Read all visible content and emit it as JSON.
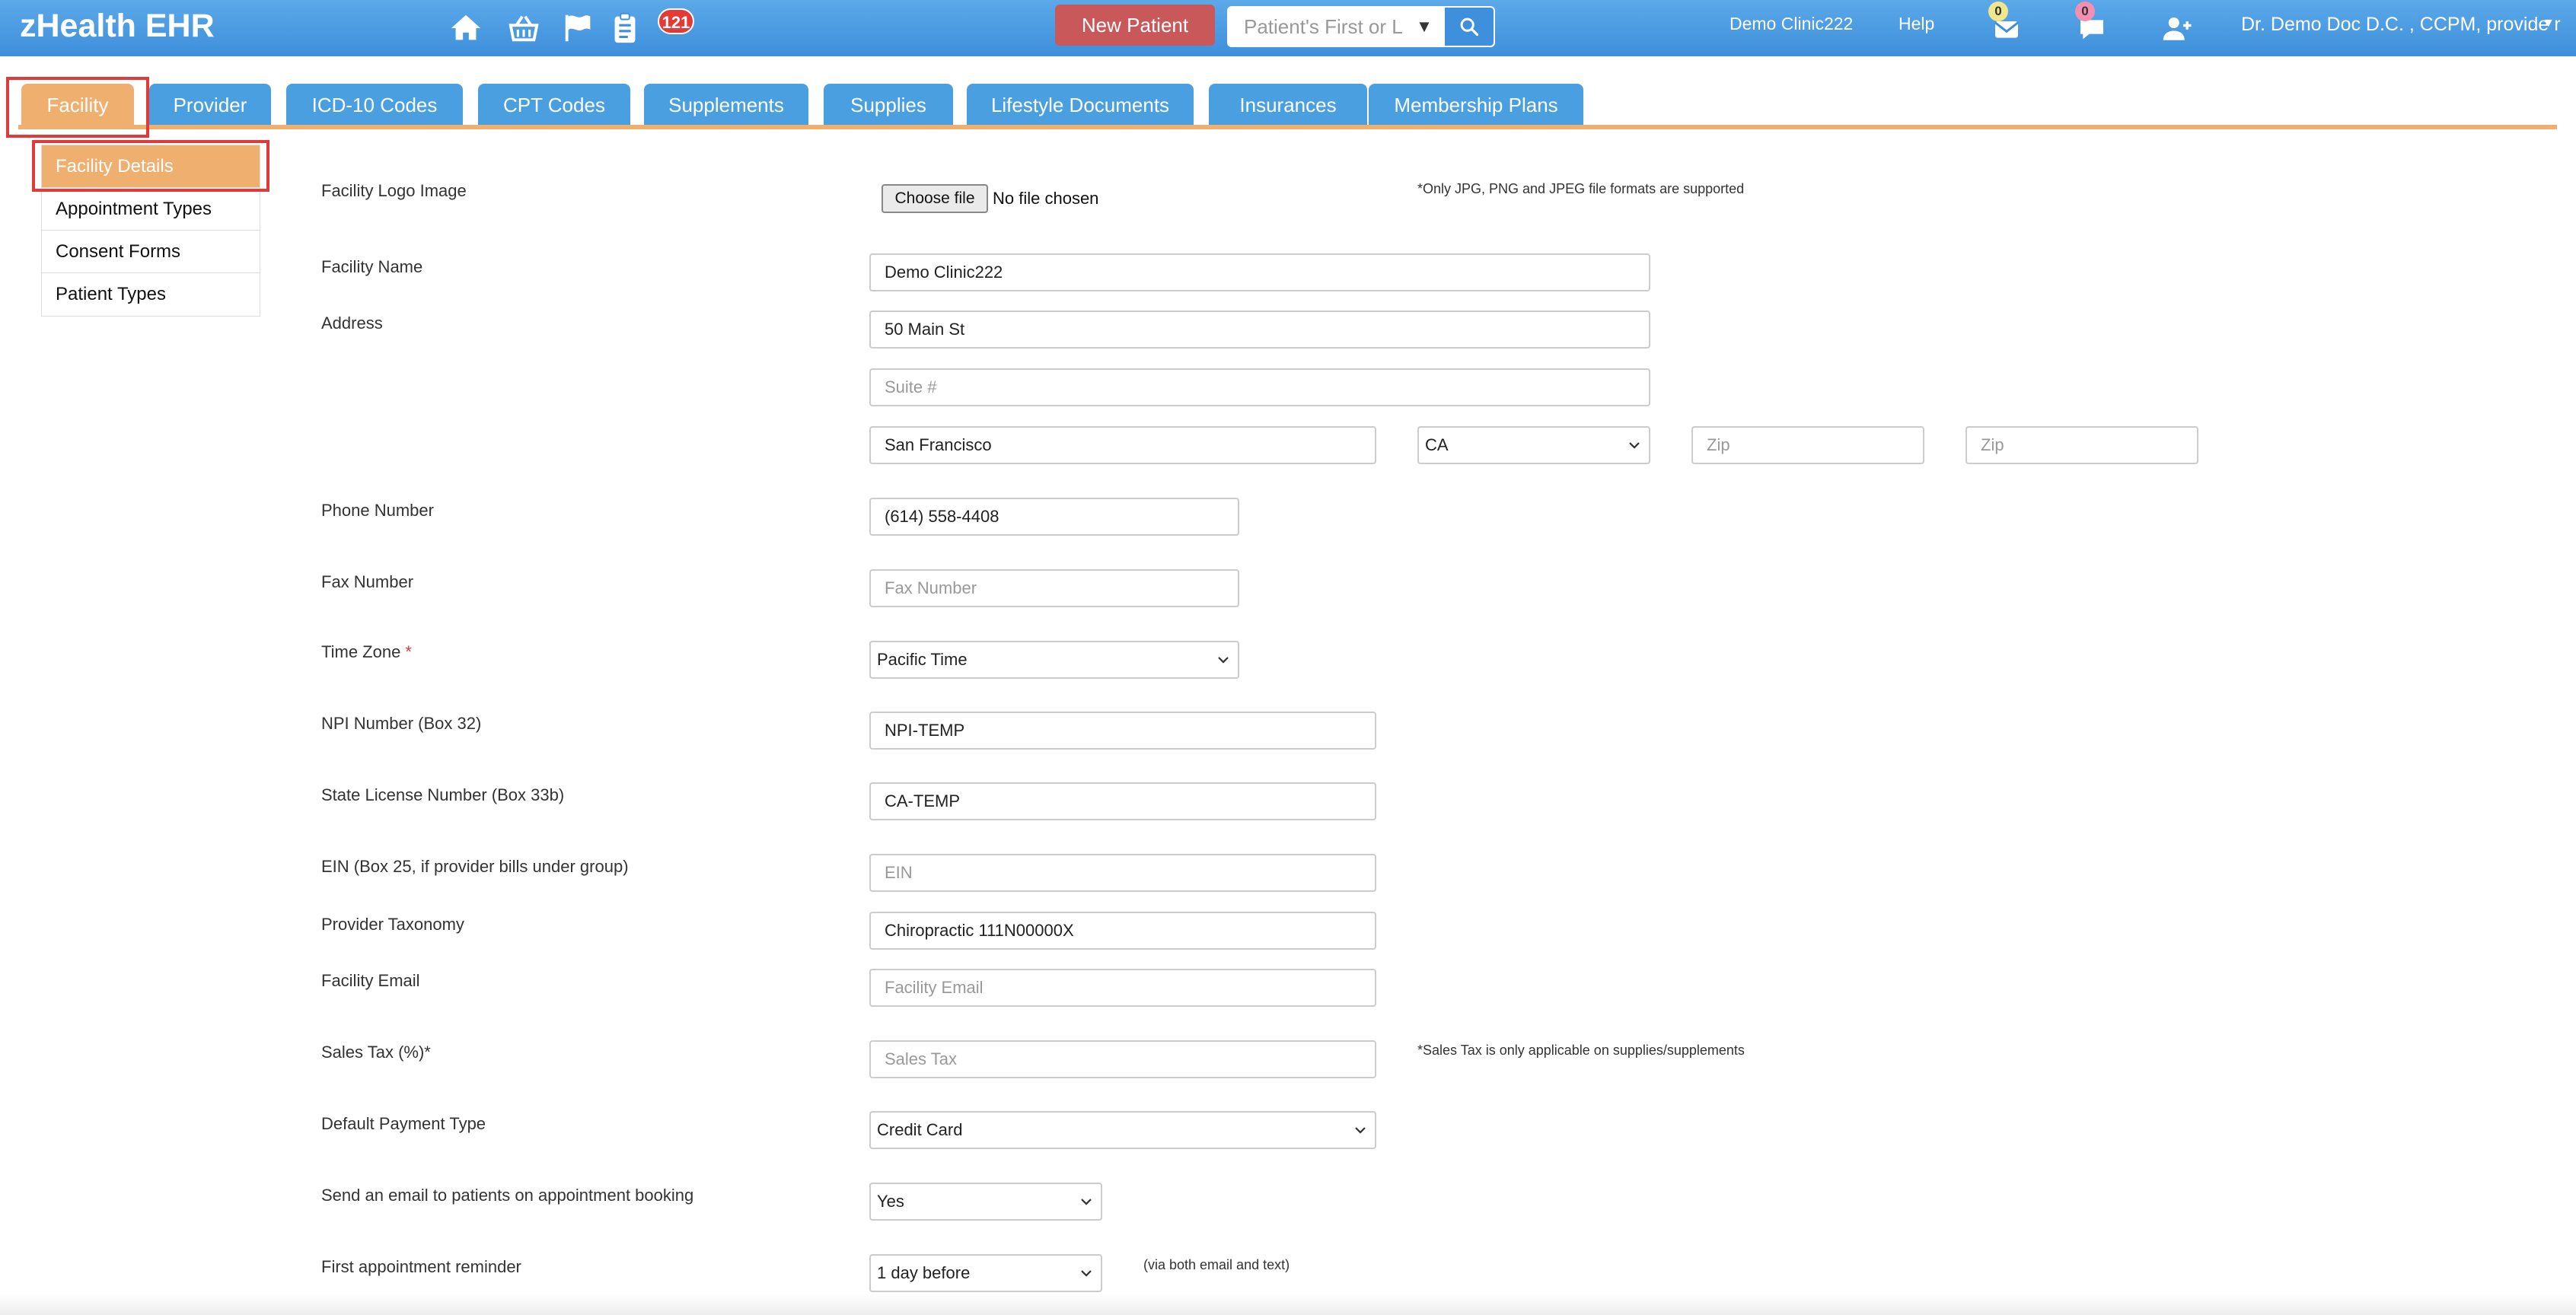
{
  "app": {
    "brand": "zHealth EHR"
  },
  "topbar": {
    "icons": [
      "home-icon",
      "basket-icon",
      "flag-icon",
      "clipboard-icon"
    ],
    "task_count": "121",
    "new_patient_label": "New Patient",
    "search_placeholder": "Patient's First or Last Name",
    "clinic_label": "Demo Clinic222",
    "help_label": "Help",
    "mail_count": "0",
    "chat_count": "0",
    "user_label": "Dr. Demo Doc D.C. , CCPM, provide r",
    "colors": {
      "bar": "#3e8fdc",
      "new_patient": "#c9585a",
      "task_badge": "#e53935",
      "mail_badge": "#f0e68c",
      "chat_badge": "#f48fb1"
    }
  },
  "tabs": [
    {
      "label": "Facility",
      "active": true
    },
    {
      "label": "Provider"
    },
    {
      "label": "ICD-10 Codes"
    },
    {
      "label": "CPT Codes"
    },
    {
      "label": "Supplements"
    },
    {
      "label": "Supplies"
    },
    {
      "label": "Lifestyle Documents"
    },
    {
      "label": "Insurances"
    },
    {
      "label": "Membership Plans"
    }
  ],
  "side_menu": [
    {
      "label": "Facility Details",
      "active": true
    },
    {
      "label": "Appointment Types"
    },
    {
      "label": "Consent Forms"
    },
    {
      "label": "Patient Types"
    }
  ],
  "form": {
    "logo": {
      "label": "Facility Logo Image",
      "button": "Choose file",
      "status": "No file chosen",
      "note": "*Only JPG, PNG and JPEG file formats are supported"
    },
    "facility_name": {
      "label": "Facility Name",
      "value": "Demo Clinic222"
    },
    "address": {
      "label": "Address",
      "line1": "50 Main St",
      "suite_placeholder": "Suite #",
      "city": "San Francisco",
      "state": "CA",
      "zip_placeholder": "Zip",
      "zip2_placeholder": "Zip"
    },
    "phone": {
      "label": "Phone Number",
      "value": "(614) 558-4408"
    },
    "fax": {
      "label": "Fax Number",
      "placeholder": "Fax Number"
    },
    "time_zone": {
      "label": "Time Zone",
      "required": "*",
      "value": "Pacific Time"
    },
    "npi": {
      "label": "NPI Number (Box 32)",
      "value": "NPI-TEMP"
    },
    "state_license": {
      "label": "State License Number (Box 33b)",
      "value": "CA-TEMP"
    },
    "ein": {
      "label": "EIN (Box 25, if provider bills under group)",
      "placeholder": "EIN"
    },
    "taxonomy": {
      "label": "Provider Taxonomy",
      "value": "Chiropractic 111N00000X"
    },
    "email": {
      "label": "Facility Email",
      "placeholder": "Facility Email"
    },
    "sales_tax": {
      "label": "Sales Tax (%)*",
      "placeholder": "Sales Tax",
      "note": "*Sales Tax is only applicable on supplies/supplements"
    },
    "payment_type": {
      "label": "Default Payment Type",
      "value": "Credit Card"
    },
    "send_email": {
      "label": "Send an email to patients on appointment booking",
      "value": "Yes"
    },
    "first_reminder": {
      "label": "First appointment reminder",
      "value": "1 day before",
      "note": "(via both email and text)"
    }
  }
}
